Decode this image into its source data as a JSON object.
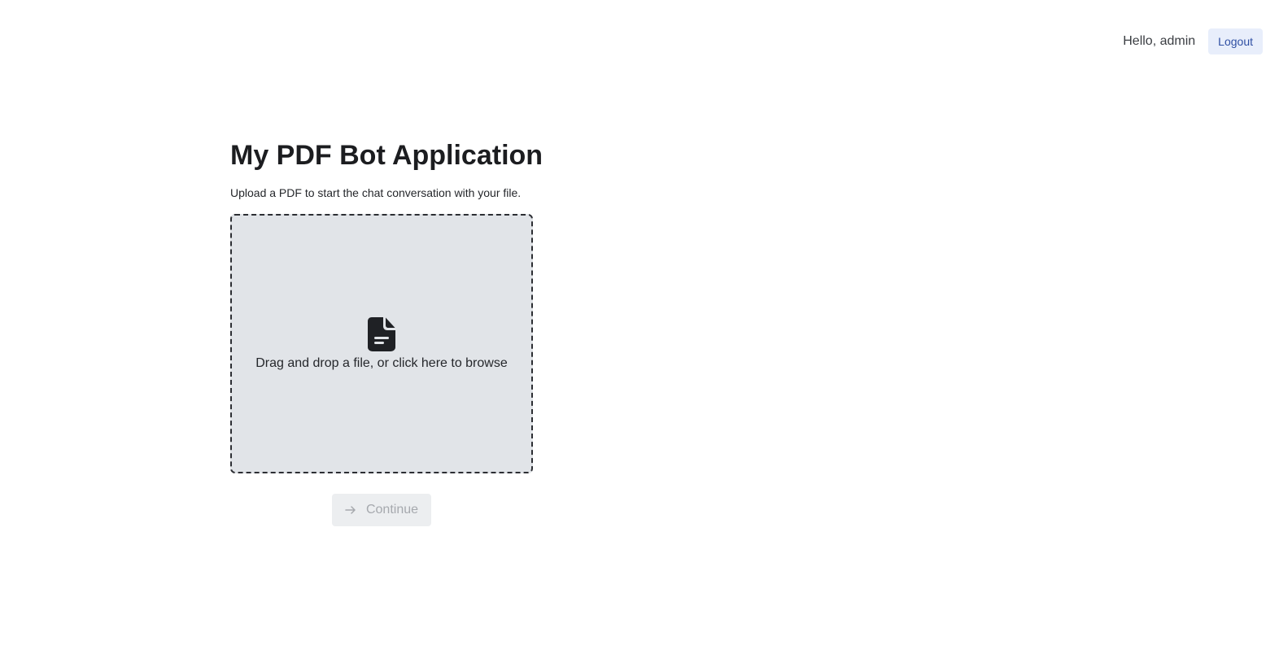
{
  "header": {
    "greeting": "Hello, admin",
    "logout_label": "Logout"
  },
  "main": {
    "title": "My PDF Bot Application",
    "subtitle": "Upload a PDF to start the chat conversation with your file.",
    "dropzone": {
      "icon": "file-document-icon",
      "text": "Drag and drop a file, or click here to browse"
    },
    "continue": {
      "label": "Continue",
      "icon": "arrow-right-icon",
      "disabled": true
    }
  },
  "colors": {
    "accent": "#2f4fa3",
    "logout_bg": "#e8eefb",
    "dropzone_bg": "#e1e4e8",
    "disabled_text": "#a6a9ae"
  }
}
